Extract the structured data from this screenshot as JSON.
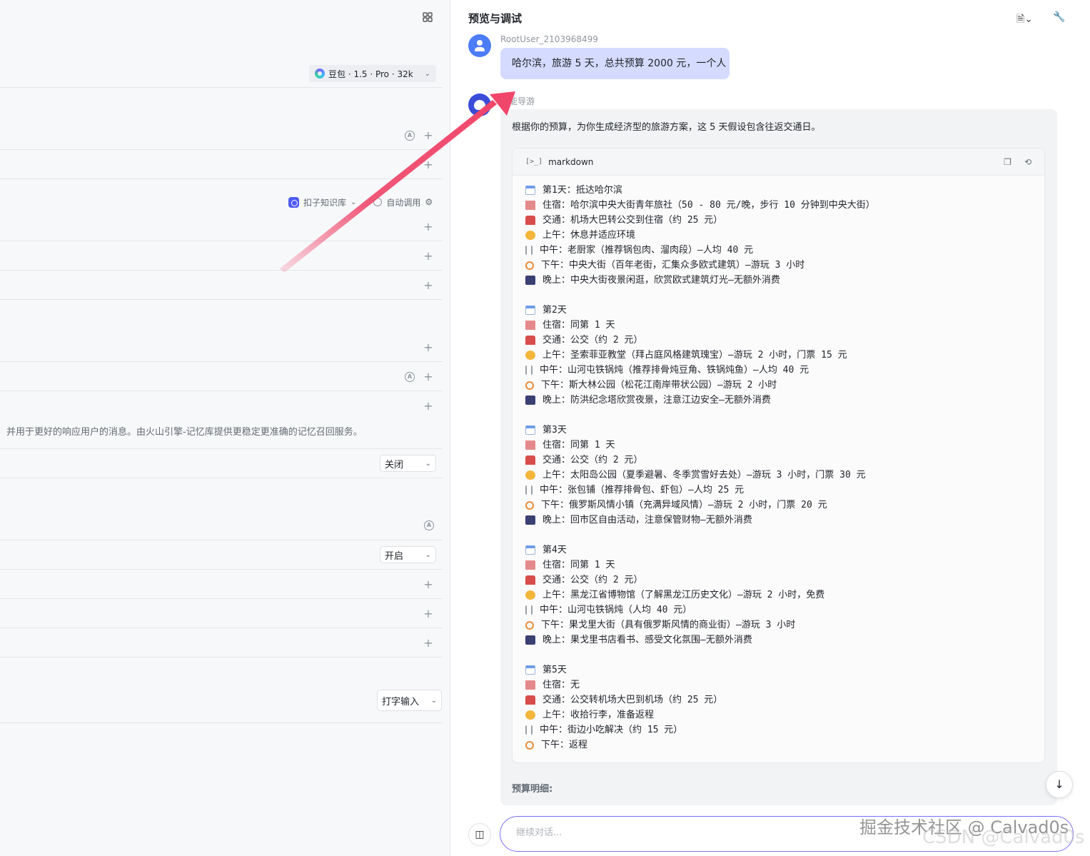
{
  "left_panel": {
    "model_chip_label": "豆包 · 1.5 · Pro · 32k",
    "knowledge_base_label": "扣子知识库",
    "auto_call_label": "自动调用",
    "memory_description": "并用于更好的响应用户的消息。由火山引擎-记忆库提供更稳定更准确的记忆召回服务。",
    "select_1_value": "关闭",
    "select_2_value": "开启",
    "input_mode_value": "打字输入",
    "auto_badge": "A",
    "plus": "+"
  },
  "preview": {
    "title": "预览与调试",
    "user_name": "RootUser_2103968499",
    "user_message": "哈尔滨，旅游 5 天，总共预算 2000 元，一个人",
    "bot_name": "智能导游",
    "bot_intro": "根据你的预算，为你生成经济型的旅游方案，这 5 天假设包含往返交通日。",
    "code_lang": "markdown",
    "code_term": "[>_]",
    "budget_heading": "预算明细:",
    "input_placeholder": "继续对话...",
    "icons": {
      "debug": "debug-icon",
      "settings": "wrench-icon",
      "copy": "copy-icon",
      "undo": "undo-icon"
    },
    "days": [
      {
        "lines": [
          {
            "icon": "calendar",
            "text": "第1天：抵达哈尔滨"
          },
          {
            "icon": "hotel",
            "text": "住宿：哈尔滨中央大街青年旅社（50 - 80 元/晚，步行 10 分钟到中央大街）"
          },
          {
            "icon": "bus",
            "text": "交通：机场大巴转公交到住宿（约 25 元）"
          },
          {
            "icon": "sun",
            "text": "上午：休息并适应环境"
          },
          {
            "icon": "food",
            "text": "中午：老厨家（推荐锅包肉、溜肉段）—人均 40 元"
          },
          {
            "icon": "bike",
            "text": "下午：中央大街（百年老街，汇集众多欧式建筑）—游玩 3 小时"
          },
          {
            "icon": "night",
            "text": "晚上：中央大街夜景闲逛，欣赏欧式建筑灯光—无额外消费"
          }
        ]
      },
      {
        "lines": [
          {
            "icon": "calendar",
            "text": "第2天"
          },
          {
            "icon": "hotel",
            "text": "住宿：同第 1 天"
          },
          {
            "icon": "bus",
            "text": "交通：公交（约 2 元）"
          },
          {
            "icon": "sun",
            "text": "上午：圣索菲亚教堂（拜占庭风格建筑瑰宝）—游玩 2 小时，门票 15 元"
          },
          {
            "icon": "food",
            "text": "中午：山河屯铁锅炖（推荐排骨炖豆角、铁锅炖鱼）—人均 40 元"
          },
          {
            "icon": "bike",
            "text": "下午：斯大林公园（松花江南岸带状公园）—游玩 2 小时"
          },
          {
            "icon": "night",
            "text": "晚上：防洪纪念塔欣赏夜景，注意江边安全—无额外消费"
          }
        ]
      },
      {
        "lines": [
          {
            "icon": "calendar",
            "text": "第3天"
          },
          {
            "icon": "hotel",
            "text": "住宿：同第 1 天"
          },
          {
            "icon": "bus",
            "text": "交通：公交（约 2 元）"
          },
          {
            "icon": "sun",
            "text": "上午：太阳岛公园（夏季避暑、冬季赏雪好去处）—游玩 3 小时，门票 30 元"
          },
          {
            "icon": "food",
            "text": "中午：张包铺（推荐排骨包、虾包）—人均 25 元"
          },
          {
            "icon": "bike",
            "text": "下午：俄罗斯风情小镇（充满异域风情）—游玩 2 小时，门票 20 元"
          },
          {
            "icon": "night",
            "text": "晚上：回市区自由活动，注意保管财物—无额外消费"
          }
        ]
      },
      {
        "lines": [
          {
            "icon": "calendar",
            "text": "第4天"
          },
          {
            "icon": "hotel",
            "text": "住宿：同第 1 天"
          },
          {
            "icon": "bus",
            "text": "交通：公交（约 2 元）"
          },
          {
            "icon": "sun",
            "text": "上午：黑龙江省博物馆（了解黑龙江历史文化）—游玩 2 小时，免费"
          },
          {
            "icon": "food",
            "text": "中午：山河屯铁锅炖（人均 40 元）"
          },
          {
            "icon": "bike",
            "text": "下午：果戈里大街（具有俄罗斯风情的商业街）—游玩 3 小时"
          },
          {
            "icon": "night",
            "text": "晚上：果戈里书店看书、感受文化氛围—无额外消费"
          }
        ]
      },
      {
        "lines": [
          {
            "icon": "calendar",
            "text": "第5天"
          },
          {
            "icon": "hotel",
            "text": "住宿：无"
          },
          {
            "icon": "bus",
            "text": "交通：公交转机场大巴到机场（约 25 元）"
          },
          {
            "icon": "sun",
            "text": "上午：收拾行李，准备返程"
          },
          {
            "icon": "food",
            "text": "中午：街边小吃解决（约 15 元）"
          },
          {
            "icon": "bike",
            "text": "下午：返程"
          }
        ]
      }
    ]
  },
  "watermark": {
    "line1": "掘金技术社区 @ Calvad0s",
    "line2": "CSDN @Calvad0s"
  },
  "colors": {
    "accent": "#4e5bf5",
    "user_bubble": "#d4dbff",
    "annotation_arrow": "#f0466a"
  }
}
